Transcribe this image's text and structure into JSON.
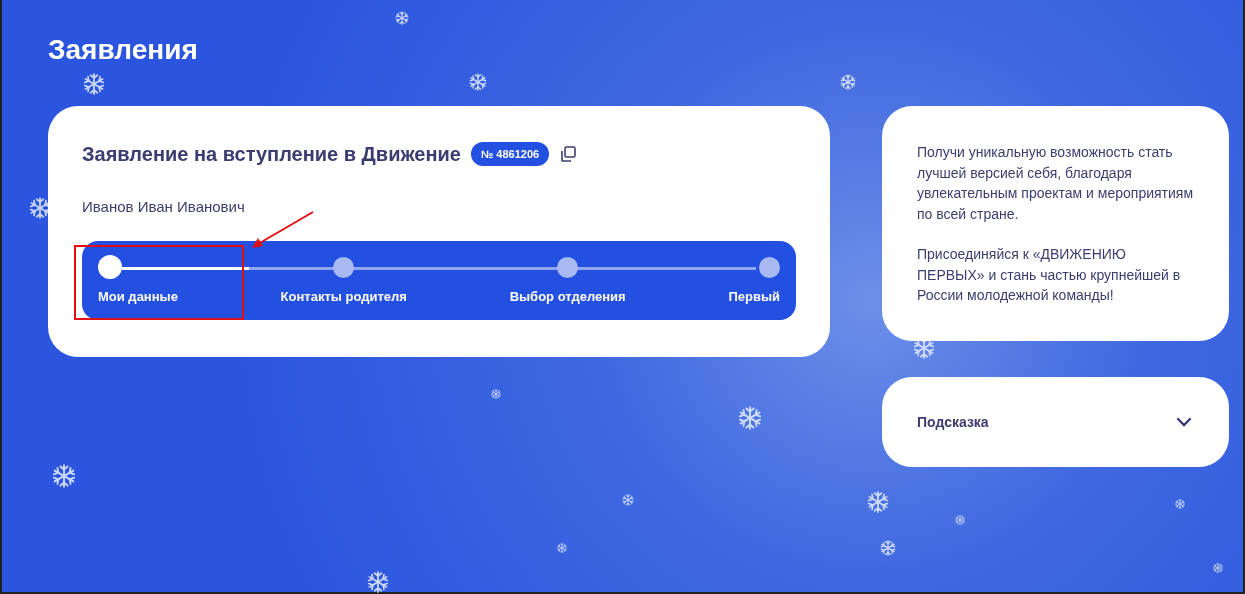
{
  "page_title": "Заявления",
  "application": {
    "title": "Заявление на вступление в Движение",
    "number": "№ 4861206",
    "applicant": "Иванов Иван Иванович",
    "progress": {
      "level": 0.2,
      "steps": [
        {
          "label": "Мои данные",
          "selected": true
        },
        {
          "label": "Контакты родителя",
          "selected": false
        },
        {
          "label": "Выбор отделения",
          "selected": false
        },
        {
          "label": "Первый",
          "selected": false
        }
      ]
    }
  },
  "info": {
    "paragraphs": [
      "Получи уникальную возможность стать лучшей версией себя, благодаря увлекательным проектам и мероприятиям по всей стране.",
      "Присоединяйся к «ДВИЖЕНИЮ ПЕРВЫХ» и стань частью крупнейшей в России молодежной команды!"
    ]
  },
  "hint": {
    "title": "Подсказка",
    "expanded": false
  }
}
